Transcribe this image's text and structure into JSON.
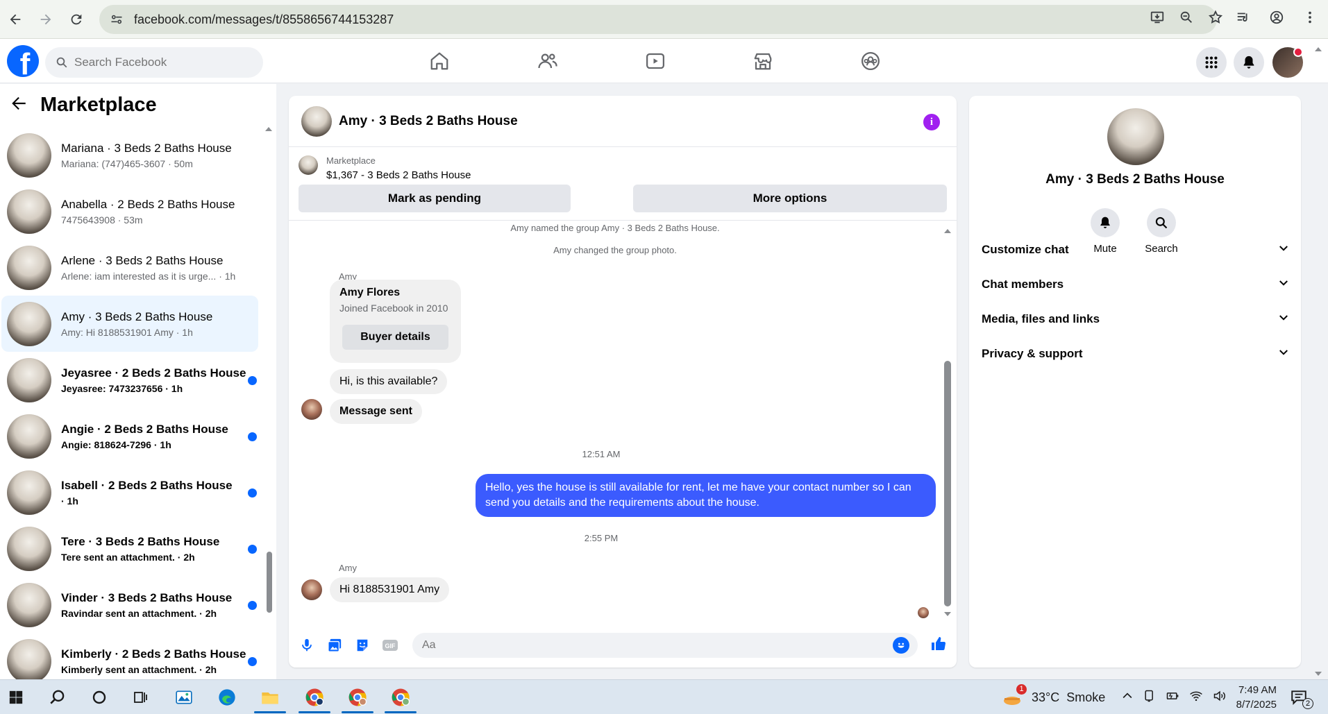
{
  "browser": {
    "url": "facebook.com/messages/t/8558656744153287"
  },
  "fb": {
    "search_placeholder": "Search Facebook"
  },
  "left": {
    "title": "Marketplace",
    "chats": [
      {
        "name": "Mariana · 3 Beds 2 Baths House",
        "sub": "Mariana: (747)465-3607 · 50m",
        "unread": false,
        "active": false
      },
      {
        "name": "Anabella · 2 Beds 2 Baths House",
        "sub": "7475643908 · 53m",
        "unread": false,
        "active": false
      },
      {
        "name": "Arlene · 3 Beds 2 Baths House",
        "sub": "Arlene: iam interested as it is urge... · 1h",
        "unread": false,
        "active": false
      },
      {
        "name": "Amy · 3 Beds 2 Baths House",
        "sub": "Amy: Hi 8188531901 Amy · 1h",
        "unread": false,
        "active": true
      },
      {
        "name": "Jeyasree · 2 Beds 2 Baths House",
        "sub": "Jeyasree: 7473237656 · 1h",
        "unread": true,
        "active": false
      },
      {
        "name": "Angie · 2 Beds 2 Baths House",
        "sub": "Angie: 818624-7296 · 1h",
        "unread": true,
        "active": false
      },
      {
        "name": "Isabell · 2 Beds 2 Baths House",
        "sub": " · 1h",
        "unread": true,
        "active": false
      },
      {
        "name": "Tere · 3 Beds 2 Baths House",
        "sub": "Tere sent an attachment. · 2h",
        "unread": true,
        "active": false
      },
      {
        "name": "Vinder · 3 Beds 2 Baths House",
        "sub": "Ravindar sent an attachment. · 2h",
        "unread": true,
        "active": false
      },
      {
        "name": "Kimberly · 2 Beds 2 Baths House",
        "sub": "Kimberly sent an attachment. · 2h",
        "unread": true,
        "active": false
      }
    ]
  },
  "chat": {
    "title": "Amy · 3 Beds 2 Baths House",
    "marketplace_label": "Marketplace",
    "listing": "$1,367 - 3 Beds 2 Baths House",
    "mark_pending": "Mark as pending",
    "more_options": "More options",
    "sys_1": "Amy named the group Amy · 3 Beds 2 Baths House.",
    "sys_2": "Amy changed the group photo.",
    "sender": "Amy",
    "profile_name": "Amy Flores",
    "profile_joined": "Joined Facebook in 2010",
    "buyer_details": "Buyer details",
    "msg_1": "Hi, is this available?",
    "msg_2": "Message sent",
    "time_1": "12:51 AM",
    "reply": "Hello, yes the house is still available for rent, let me have your contact number so I can send you details and the requirements about the house.",
    "time_2": "2:55 PM",
    "msg_3": "Hi 8188531901 Amy",
    "composer_placeholder": "Aa"
  },
  "info": {
    "name": "Amy · 3 Beds 2 Baths House",
    "mute": "Mute",
    "search": "Search",
    "sections": [
      "Customize chat",
      "Chat members",
      "Media, files and links",
      "Privacy & support"
    ]
  },
  "taskbar": {
    "weather": "33°C  Smoke",
    "weather_badge": "1",
    "time": "7:49 AM",
    "date": "8/7/2025",
    "notif_count": "2"
  },
  "colors": {
    "fb_blue": "#0866ff",
    "outgoing_bubble": "#3b5bfe",
    "info_purple": "#a020f0",
    "active_chat_bg": "#ebf5ff"
  }
}
